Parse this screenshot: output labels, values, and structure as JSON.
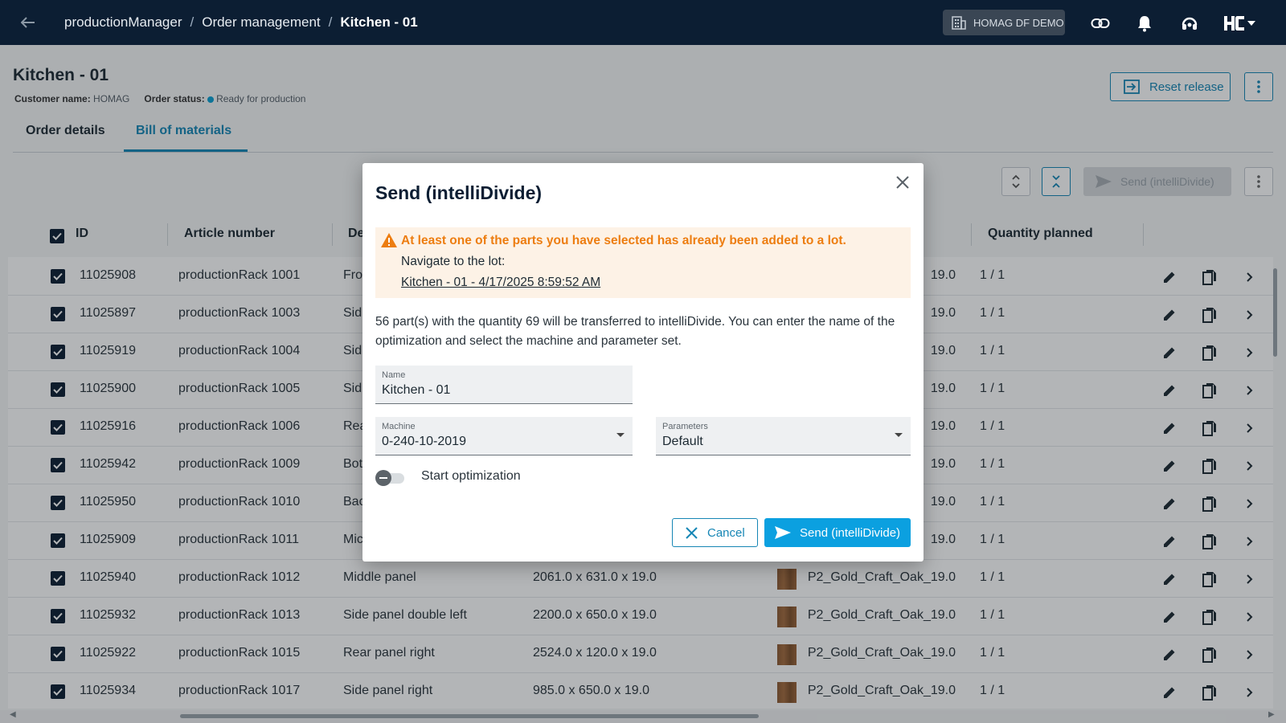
{
  "topbar": {
    "breadcrumb": [
      "productionManager",
      "Order management",
      "Kitchen - 01"
    ],
    "separator": "/",
    "tenant": "HOMAG DF DEMO",
    "icons": [
      "back-arrow-icon",
      "building-icon",
      "link-icon",
      "bell-icon",
      "headset-icon",
      "user-initials-logo"
    ]
  },
  "page": {
    "title": "Kitchen - 01",
    "customer_label": "Customer name:",
    "customer_value": "HOMAG",
    "status_label": "Order status:",
    "status_value": "Ready for production",
    "reset_release": "Reset release",
    "tabs": [
      "Order details",
      "Bill of materials"
    ],
    "active_tab": "Bill of materials"
  },
  "toolbar": {
    "send_disabled": "Send (intelliDivide)"
  },
  "table": {
    "headers": [
      "ID",
      "Article number",
      "De",
      "Quantity planned"
    ],
    "rows": [
      {
        "id": "11025908",
        "article": "productionRack 1001",
        "desc": "Fro",
        "dims": "",
        "material": "19.0",
        "qty": "1 / 1"
      },
      {
        "id": "11025897",
        "article": "productionRack 1003",
        "desc": "Sid",
        "dims": "",
        "material": "19.0",
        "qty": "1 / 1"
      },
      {
        "id": "11025919",
        "article": "productionRack 1004",
        "desc": "Sid",
        "dims": "",
        "material": "19.0",
        "qty": "1 / 1"
      },
      {
        "id": "11025900",
        "article": "productionRack 1005",
        "desc": "Sid",
        "dims": "",
        "material": "19.0",
        "qty": "1 / 1"
      },
      {
        "id": "11025916",
        "article": "productionRack 1006",
        "desc": "Rea",
        "dims": "",
        "material": "19.0",
        "qty": "1 / 1"
      },
      {
        "id": "11025942",
        "article": "productionRack 1009",
        "desc": "Bot",
        "dims": "",
        "material": "19.0",
        "qty": "1 / 1"
      },
      {
        "id": "11025950",
        "article": "productionRack 1010",
        "desc": "Bac",
        "dims": "",
        "material": "19.0",
        "qty": "1 / 1"
      },
      {
        "id": "11025909",
        "article": "productionRack 1011",
        "desc": "Mic",
        "dims": "",
        "material": "19.0",
        "qty": "1 / 1"
      },
      {
        "id": "11025940",
        "article": "productionRack 1012",
        "desc": "Middle panel",
        "dims": "2061.0 x 631.0 x 19.0",
        "material": "P2_Gold_Craft_Oak_19.0",
        "qty": "1 / 1"
      },
      {
        "id": "11025932",
        "article": "productionRack 1013",
        "desc": "Side panel double left",
        "dims": "2200.0 x 650.0 x 19.0",
        "material": "P2_Gold_Craft_Oak_19.0",
        "qty": "1 / 1"
      },
      {
        "id": "11025922",
        "article": "productionRack 1015",
        "desc": "Rear panel right",
        "dims": "2524.0 x 120.0 x 19.0",
        "material": "P2_Gold_Craft_Oak_19.0",
        "qty": "1 / 1"
      },
      {
        "id": "11025934",
        "article": "productionRack 1017",
        "desc": "Side panel right",
        "dims": "985.0 x 650.0 x 19.0",
        "material": "P2_Gold_Craft_Oak_19.0",
        "qty": "1 / 1"
      }
    ]
  },
  "dialog": {
    "title": "Send (intelliDivide)",
    "warning_title": "At least one of the parts you have selected has already been added to a lot.",
    "warning_nav": "Navigate to the lot:",
    "warning_link": "Kitchen - 01 - 4/17/2025 8:59:52 AM",
    "text": "56 part(s) with the quantity 69 will be transferred to intelliDivide. You can enter the name of the optimization and select the machine and parameter set.",
    "name_label": "Name",
    "name_value": "Kitchen - 01",
    "machine_label": "Machine",
    "machine_value": "0-240-10-2019",
    "params_label": "Parameters",
    "params_value": "Default",
    "toggle_label": "Start optimization",
    "toggle_on": false,
    "cancel": "Cancel",
    "send": "Send (intelliDivide)"
  },
  "colors": {
    "topbar": "#0c1e33",
    "accent": "#1686b5",
    "primary_button": "#0ba0e0",
    "warning": "#ed7d10",
    "warning_bg": "#fdf2e6"
  }
}
